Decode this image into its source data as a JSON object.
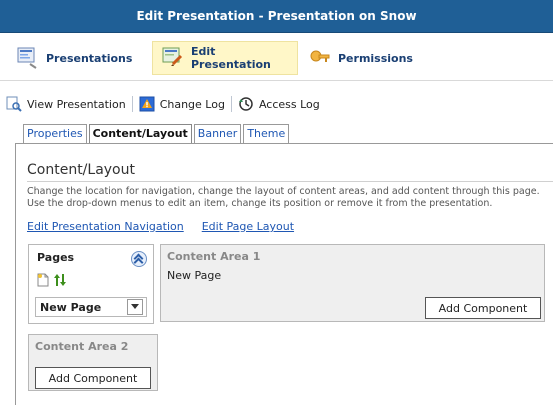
{
  "window": {
    "title": "Edit Presentation - Presentation on Snow"
  },
  "nav": {
    "presentations": "Presentations",
    "edit_presentation": "Edit Presentation",
    "permissions": "Permissions"
  },
  "toolbar": {
    "view": "View Presentation",
    "changelog": "Change Log",
    "access": "Access Log"
  },
  "tabs": [
    "Properties",
    "Content/Layout",
    "Banner",
    "Theme"
  ],
  "content": {
    "heading": "Content/Layout",
    "description": "Change the location for navigation, change the layout of content areas, and add content through this page. Use the drop-down menus to edit an item, change its position or remove it from the presentation.",
    "links": [
      "Edit Presentation Navigation",
      "Edit Page Layout"
    ]
  },
  "pages_panel": {
    "title": "Pages",
    "selected": "New Page"
  },
  "areas": [
    {
      "title": "Content Area 1",
      "content": "New Page",
      "button": "Add Component"
    },
    {
      "title": "Content Area 2",
      "button": "Add Component"
    }
  ],
  "icons": {
    "presentations": "presentations-icon",
    "edit": "edit-presentation-icon",
    "permissions": "permissions-icon",
    "view": "view-presentation-icon",
    "changelog": "change-log-icon",
    "access": "access-log-icon",
    "collapse": "collapse-icon",
    "new_page": "new-page-icon",
    "sort": "sort-icon",
    "dropdown": "chevron-down-icon"
  },
  "colors": {
    "title_bar": "#1f5f96",
    "link": "#1f57b3",
    "active_nav_bg": "#fff7c8"
  }
}
